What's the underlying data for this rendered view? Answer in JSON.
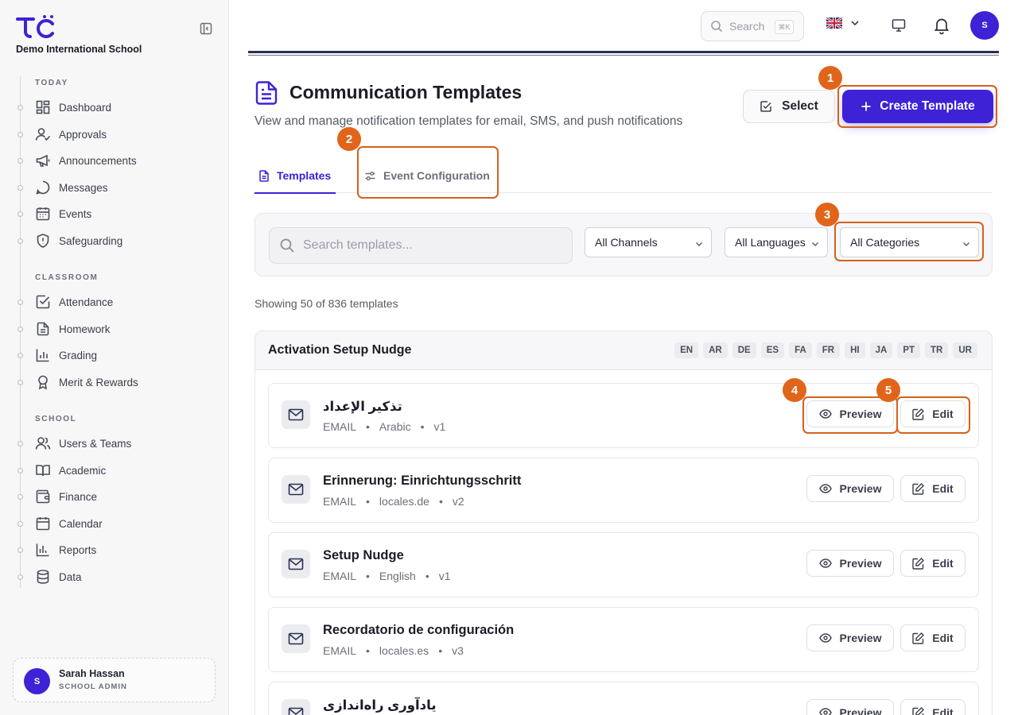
{
  "sidebar": {
    "school_name": "Demo International School",
    "sections": {
      "today": "TODAY",
      "classroom": "CLASSROOM",
      "school": "SCHOOL"
    },
    "items": {
      "dashboard": "Dashboard",
      "approvals": "Approvals",
      "announcements": "Announcements",
      "messages": "Messages",
      "events": "Events",
      "safeguarding": "Safeguarding",
      "attendance": "Attendance",
      "homework": "Homework",
      "grading": "Grading",
      "merit": "Merit & Rewards",
      "users": "Users & Teams",
      "academic": "Academic",
      "finance": "Finance",
      "calendar": "Calendar",
      "reports": "Reports",
      "data": "Data"
    },
    "user": {
      "initial": "S",
      "name": "Sarah Hassan",
      "role": "SCHOOL ADMIN"
    }
  },
  "topbar": {
    "search_placeholder": "Search",
    "search_shortcut": "⌘K",
    "avatar_initial": "S"
  },
  "header": {
    "title": "Communication Templates",
    "subtitle": "View and manage notification templates for email, SMS, and push notifications",
    "select_label": "Select",
    "create_label": "Create Template"
  },
  "tabs": {
    "templates": "Templates",
    "event_config": "Event Configuration"
  },
  "filters": {
    "search_placeholder": "Search templates...",
    "channels": "All Channels",
    "languages": "All Languages",
    "categories": "All Categories"
  },
  "showing": "Showing 50 of 836 templates",
  "group": {
    "title": "Activation Setup Nudge",
    "langs": [
      "EN",
      "AR",
      "DE",
      "ES",
      "FA",
      "FR",
      "HI",
      "JA",
      "PT",
      "TR",
      "UR"
    ]
  },
  "row_buttons": {
    "preview": "Preview",
    "edit": "Edit"
  },
  "rows": [
    {
      "name": "تذكير الإعداد",
      "channel": "EMAIL",
      "locale": "Arabic",
      "version": "v1"
    },
    {
      "name": "Erinnerung: Einrichtungsschritt",
      "channel": "EMAIL",
      "locale": "locales.de",
      "version": "v2"
    },
    {
      "name": "Setup Nudge",
      "channel": "EMAIL",
      "locale": "English",
      "version": "v1"
    },
    {
      "name": "Recordatorio de configuración",
      "channel": "EMAIL",
      "locale": "locales.es",
      "version": "v3"
    },
    {
      "name": "یادآوری راه‌اندازی",
      "channel": "",
      "locale": "",
      "version": ""
    }
  ],
  "markers": [
    "1",
    "2",
    "3",
    "4",
    "5"
  ],
  "colors": {
    "accent": "#3d22d6",
    "annotation": "#e0651a"
  }
}
